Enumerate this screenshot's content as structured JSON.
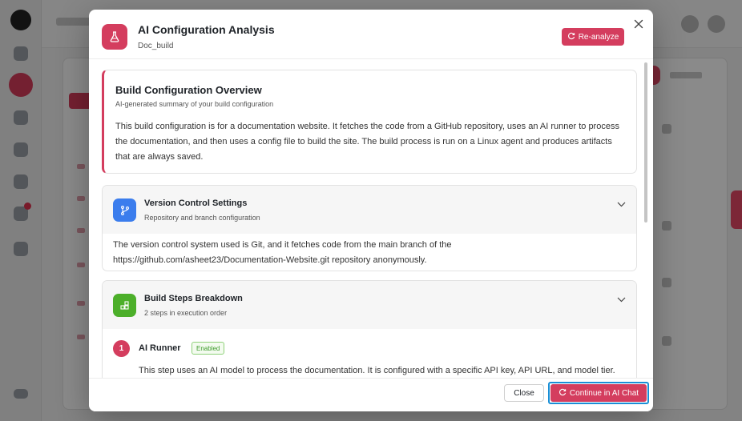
{
  "modal": {
    "title": "AI Configuration Analysis",
    "subtitle": "Doc_build",
    "reanalyze_label": "Re-analyze",
    "header_icon": "flask-icon",
    "accent_color": "#d43d5e"
  },
  "overview": {
    "title": "Build Configuration Overview",
    "subtitle": "AI-generated summary of your build configuration",
    "text": "This build configuration is for a documentation website. It fetches the code from a GitHub repository, uses an AI runner to process the documentation, and then uses a config file to build the site. The build process is run on a Linux agent and produces artifacts that are always saved."
  },
  "vcs": {
    "title": "Version Control Settings",
    "subtitle": "Repository and branch configuration",
    "icon": "branch-icon",
    "icon_color": "#3b7ded",
    "text": "The version control system used is Git, and it fetches code from the main branch of the https://github.com/asheet23/Documentation-Website.git repository anonymously."
  },
  "build_steps": {
    "title": "Build Steps Breakdown",
    "subtitle": "2 steps in execution order",
    "icon": "blocks-icon",
    "icon_color": "#4caf2a",
    "steps": [
      {
        "number": "1",
        "name": "AI Runner",
        "status": "Enabled",
        "description": "This step uses an AI model to process the documentation. It is configured with a specific API key, API URL, and model tier."
      }
    ]
  },
  "footer": {
    "close_label": "Close",
    "chat_label": "Continue in AI Chat"
  }
}
